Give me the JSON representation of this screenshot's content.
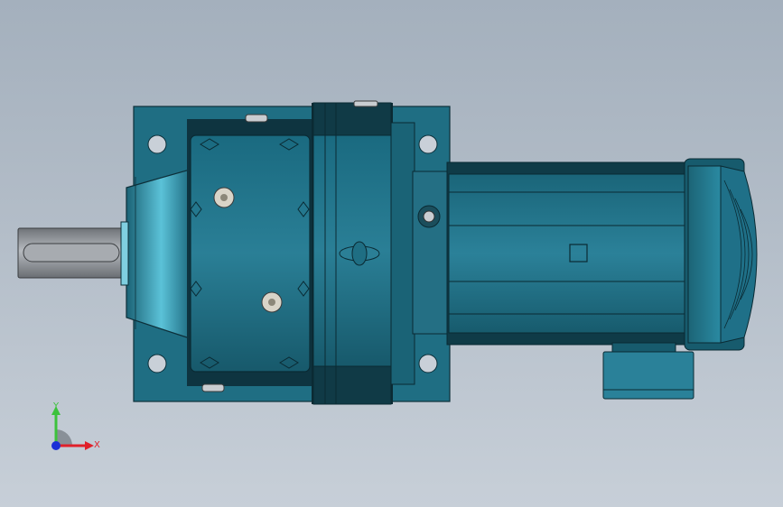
{
  "viewport": {
    "background_top": "#a4b0bd",
    "background_bottom": "#c7cfd8"
  },
  "model": {
    "description_icon": "gear-motor-model",
    "body_color": "#1e6f86",
    "body_dark": "#0f3f4d",
    "shaft_color": "#9a9ea4"
  },
  "triad": {
    "x_label": "X",
    "y_label": "Y",
    "x_color": "#e0202a",
    "y_color": "#3cc23c",
    "z_color": "#1b2fd6"
  }
}
